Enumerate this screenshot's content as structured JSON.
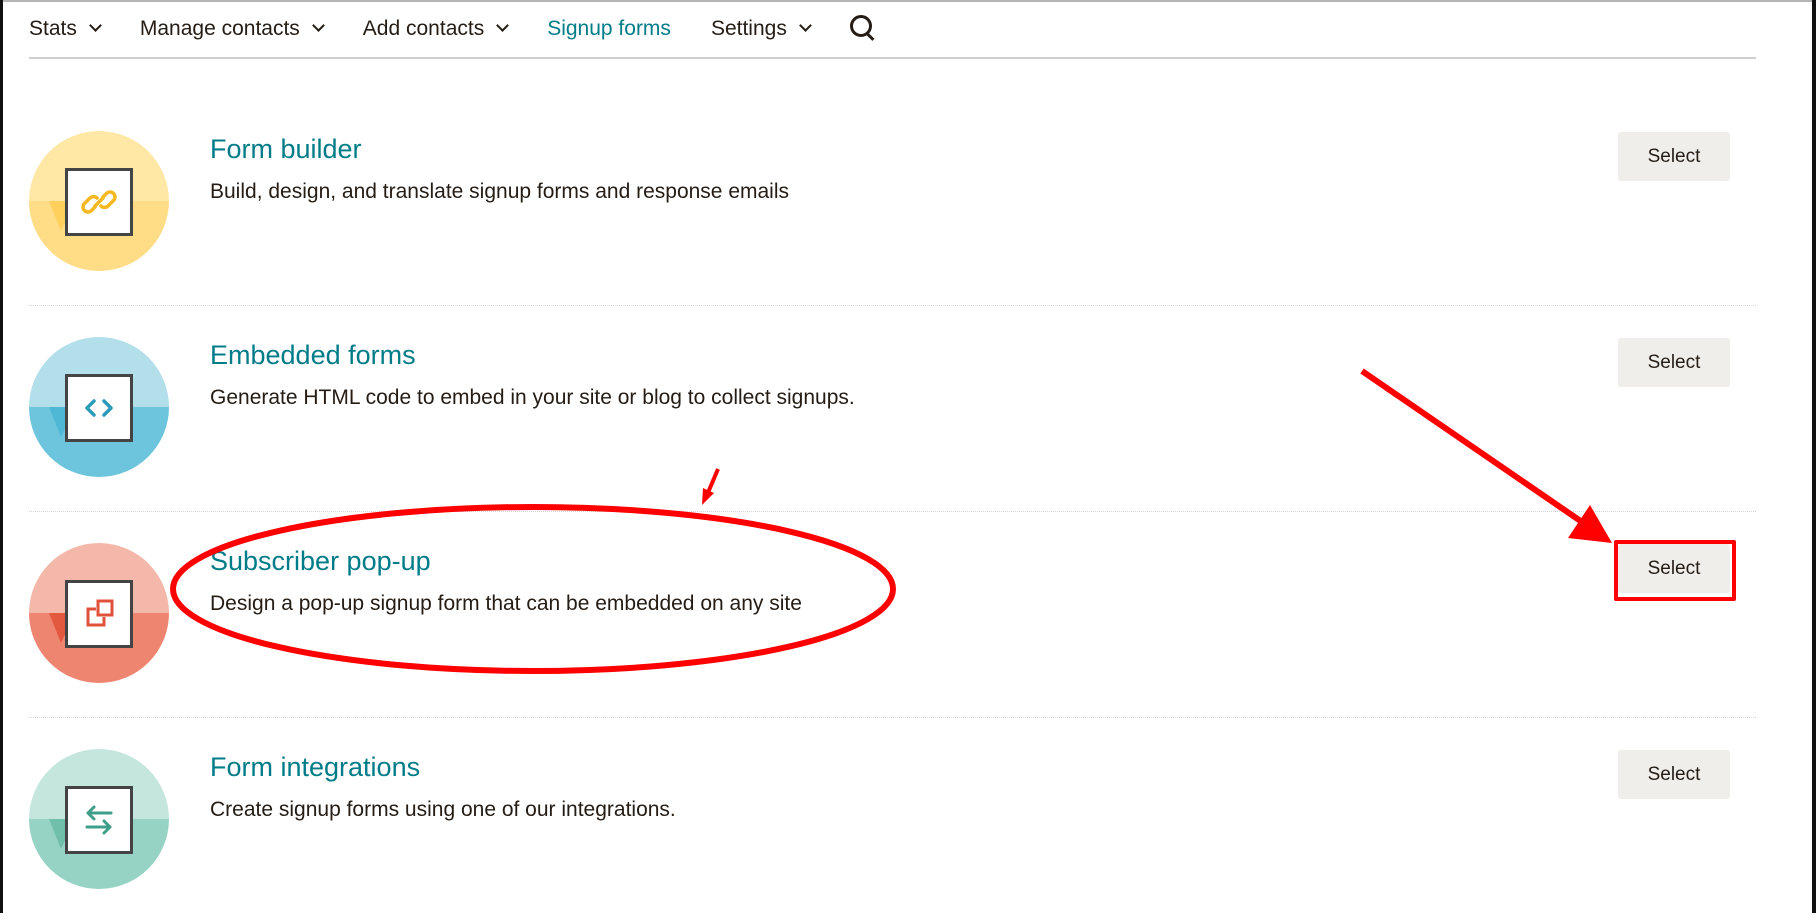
{
  "nav": {
    "items": [
      {
        "label": "Stats",
        "has_dropdown": true,
        "active": false
      },
      {
        "label": "Manage contacts",
        "has_dropdown": true,
        "active": false
      },
      {
        "label": "Add contacts",
        "has_dropdown": true,
        "active": false
      },
      {
        "label": "Signup forms",
        "has_dropdown": false,
        "active": true
      },
      {
        "label": "Settings",
        "has_dropdown": true,
        "active": false
      }
    ],
    "search_icon": "search-icon"
  },
  "forms": [
    {
      "title": "Form builder",
      "description": "Build, design, and translate signup forms and response emails",
      "icon": "link-icon",
      "button": "Select",
      "colors": {
        "light": "#ffe7a6",
        "dark": "#ffdd87",
        "glyph": "#f5b820"
      }
    },
    {
      "title": "Embedded forms",
      "description": "Generate HTML code to embed in your site or blog to collect signups.",
      "icon": "code-icon",
      "button": "Select",
      "colors": {
        "light": "#b2dfea",
        "dark": "#6cc5dc",
        "glyph": "#2b9bb8"
      }
    },
    {
      "title": "Subscriber pop-up",
      "description": "Design a pop-up signup form that can be embedded on any site",
      "icon": "popup-icon",
      "button": "Select",
      "colors": {
        "light": "#f4b8ab",
        "dark": "#ee8570",
        "glyph": "#e0533a"
      }
    },
    {
      "title": "Form integrations",
      "description": "Create signup forms using one of our integrations.",
      "icon": "swap-arrows-icon",
      "button": "Select",
      "colors": {
        "light": "#c4e6dd",
        "dark": "#97d3c5",
        "glyph": "#3f9e88"
      }
    }
  ],
  "annotations": {
    "color": "#ff0000",
    "highlighted_item": "Subscriber pop-up",
    "highlighted_button": "Select"
  },
  "theme": {
    "accent": "#007c89",
    "text": "#241c15",
    "button_bg": "#efeeea"
  }
}
